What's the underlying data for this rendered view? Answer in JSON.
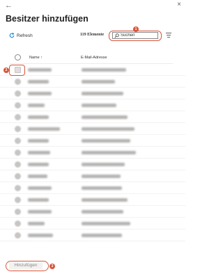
{
  "topbar": {
    "back_glyph": "←",
    "close_glyph": "×"
  },
  "title": "Besitzer hinzufügen",
  "toolbar": {
    "refresh_label": "Refresh",
    "count_label": "119 Elemente",
    "search_placeholder": "Suchen"
  },
  "annotations": {
    "search_badge": "1",
    "row_badge": "2",
    "add_badge": "3"
  },
  "table": {
    "columns": {
      "name": "Name ↑",
      "email": "E-Mail-Adresse"
    }
  },
  "rows_count": 15,
  "footer": {
    "add_label": "Hinzufügen"
  },
  "colors": {
    "accent": "#d6573b",
    "refresh_icon": "#0078d4"
  },
  "icons": [
    "back-arrow-icon",
    "close-icon",
    "refresh-icon",
    "search-icon",
    "filter-icon"
  ]
}
